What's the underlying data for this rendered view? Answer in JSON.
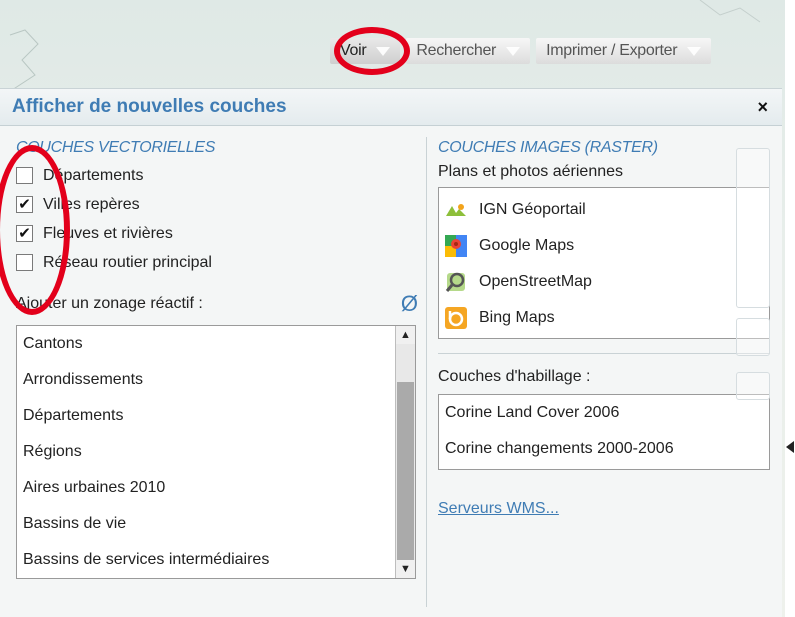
{
  "toolbar": {
    "voir": "Voir",
    "rechercher": "Rechercher",
    "imprimer": "Imprimer / Exporter"
  },
  "panel": {
    "title": "Afficher de nouvelles couches",
    "close": "×"
  },
  "vector": {
    "title": "COUCHES VECTORIELLES",
    "items": [
      {
        "label": "Départements",
        "checked": false,
        "mark": ""
      },
      {
        "label": "Villes repères",
        "checked": true,
        "mark": "✔"
      },
      {
        "label": "Fleuves et rivières",
        "checked": true,
        "mark": "✔"
      },
      {
        "label": "Réseau routier principal",
        "checked": false,
        "mark": ""
      }
    ],
    "zonage_label": "Ajouter un zonage réactif :",
    "zonage_clear_icon": "Ø",
    "zonage_items": [
      "Cantons",
      "Arrondissements",
      "Départements",
      "Régions",
      "Aires urbaines 2010",
      "Bassins de vie",
      "Bassins de services intermédiaires"
    ]
  },
  "raster": {
    "title": "COUCHES IMAGES (RASTER)",
    "subtitle": "Plans et photos aériennes",
    "items": [
      {
        "label": "IGN Géoportail",
        "icon": "ign-icon"
      },
      {
        "label": "Google Maps",
        "icon": "google-maps-icon"
      },
      {
        "label": "OpenStreetMap",
        "icon": "openstreetmap-icon"
      },
      {
        "label": "Bing Maps",
        "icon": "bing-icon"
      }
    ],
    "habillage_label": "Couches d'habillage :",
    "habillage_items": [
      "Corine Land Cover 2006",
      "Corine changements 2000-2006"
    ],
    "wms_link": "Serveurs WMS..."
  },
  "colors": {
    "accent": "#3f7cb4",
    "highlight": "#e3001b"
  }
}
